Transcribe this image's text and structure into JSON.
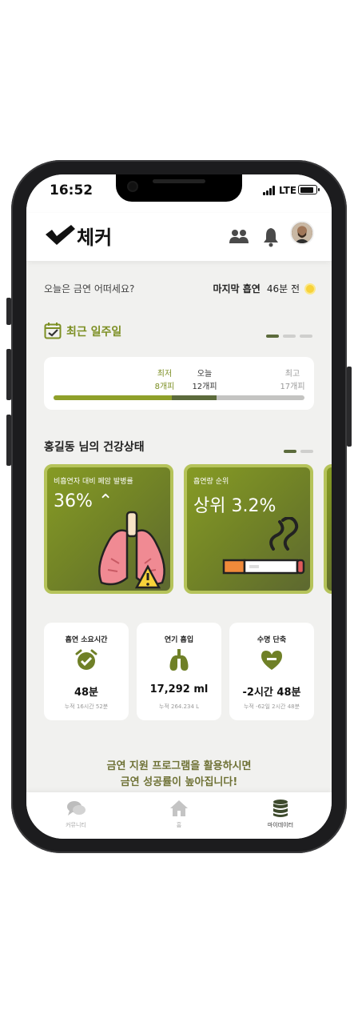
{
  "status_bar": {
    "time": "16:52",
    "network": "LTE"
  },
  "header": {
    "app_name": "체커"
  },
  "greeting": {
    "question": "오늘은 금연 어떠세요?",
    "last_smoke_label": "마지막 흡연",
    "last_smoke_value": "46분 전"
  },
  "recent_week": {
    "title": "최근 일주일",
    "min_label": "최저",
    "min_value": "8개피",
    "today_label": "오늘",
    "today_value": "12개피",
    "max_label": "최고",
    "max_value": "17개피",
    "min_fraction": 0.47,
    "today_fraction": 0.65
  },
  "health": {
    "title": "홍길동 님의 건강상태",
    "cards": [
      {
        "title": "비흡연자 대비 폐암 발병률",
        "value": "36% ⌃"
      },
      {
        "title": "흡연량 순위",
        "value": "상위 3.2%"
      }
    ]
  },
  "stats": [
    {
      "title": "흡연 소요시간",
      "value": "48분",
      "sub": "누적 16시간 52분",
      "icon": "alarm-clock-check-icon"
    },
    {
      "title": "연기 흡입",
      "value": "17,292 ml",
      "sub": "누적 264.234 L",
      "icon": "lungs-icon"
    },
    {
      "title": "수명 단축",
      "value": "-2시간 48분",
      "sub": "누적 -62일 2시간 48분",
      "icon": "heart-minus-icon"
    }
  ],
  "promo": {
    "line1": "금연 지원 프로그램을 활용하시면",
    "line2": "금연 성공률이 높아집니다!"
  },
  "tabs": [
    {
      "label": "커뮤니티",
      "icon": "chat-bubbles-icon",
      "active": false
    },
    {
      "label": "홈",
      "icon": "home-icon",
      "active": false
    },
    {
      "label": "마이데이터",
      "icon": "database-icon",
      "active": true
    }
  ],
  "colors": {
    "accent": "#8fa02a",
    "accent_dark": "#5c6b3c",
    "title_green": "#7c8f23",
    "background": "#f1f1ef"
  }
}
